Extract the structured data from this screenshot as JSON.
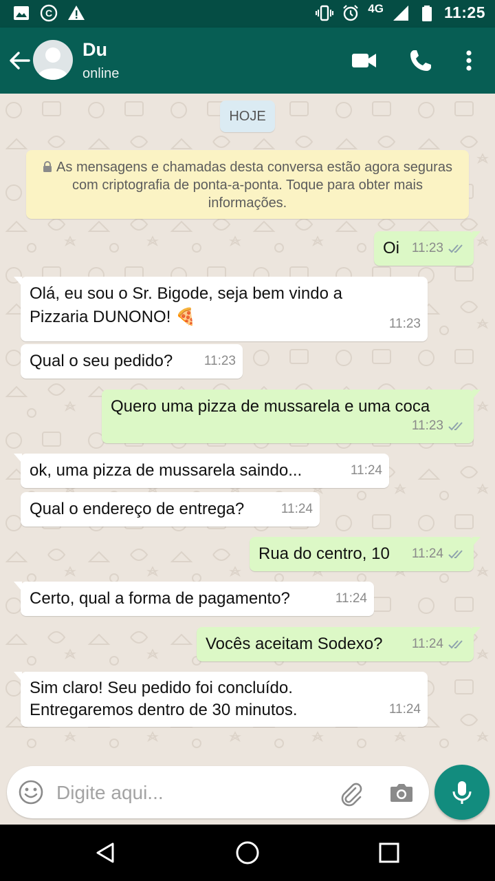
{
  "status_bar": {
    "network": "4G",
    "time": "11:25",
    "icons": [
      "image-icon",
      "copyright-icon",
      "warning-icon",
      "vibrate-icon",
      "alarm-icon",
      "signal-icon",
      "battery-icon"
    ]
  },
  "header": {
    "contact_name": "Du",
    "contact_status": "online",
    "icons": [
      "back-arrow-icon",
      "avatar-icon",
      "video-call-icon",
      "phone-icon",
      "more-vert-icon"
    ]
  },
  "chat": {
    "date_label": "HOJE",
    "encryption_notice": "As mensagens e chamadas desta conversa estão agora seguras com criptografia de ponta-a-ponta. Toque para obter mais informações.",
    "messages": [
      {
        "dir": "out",
        "lines": [
          "Oi"
        ],
        "time": "11:23",
        "read": true
      },
      {
        "dir": "in",
        "lines": [
          "Olá, eu sou o Sr. Bigode, seja bem vindo a",
          "Pizzaria DUNONO! 🍕"
        ],
        "time": "11:23"
      },
      {
        "dir": "in",
        "lines": [
          "Qual o seu pedido?"
        ],
        "time": "11:23"
      },
      {
        "dir": "out",
        "lines": [
          "Quero uma pizza de mussarela e uma coca"
        ],
        "time": "11:23",
        "read": true
      },
      {
        "dir": "in",
        "lines": [
          "ok, uma pizza de mussarela saindo..."
        ],
        "time": "11:24"
      },
      {
        "dir": "in",
        "lines": [
          "Qual o endereço de entrega?"
        ],
        "time": "11:24"
      },
      {
        "dir": "out",
        "lines": [
          "Rua do centro, 10"
        ],
        "time": "11:24",
        "read": true
      },
      {
        "dir": "in",
        "lines": [
          "Certo, qual a forma de pagamento?"
        ],
        "time": "11:24"
      },
      {
        "dir": "out",
        "lines": [
          "Vocês aceitam Sodexo?"
        ],
        "time": "11:24",
        "read": true
      },
      {
        "dir": "in",
        "lines": [
          "Sim claro! Seu pedido foi concluído.",
          "Entregaremos dentro de 30 minutos."
        ],
        "time": "11:24"
      }
    ]
  },
  "composer": {
    "placeholder": "Digite aqui...",
    "icons": [
      "emoji-icon",
      "attach-icon",
      "camera-icon",
      "mic-icon"
    ]
  },
  "colors": {
    "status_bar": "#054D44",
    "header": "#075E54",
    "chat_bg": "#ECE5DD",
    "incoming_bubble": "#FFFFFF",
    "outgoing_bubble": "#DCF8C6",
    "notice_bg": "#FBF3C4",
    "date_chip": "#DBEBF3",
    "mic_button": "#128C7E",
    "read_ticks": "#8FA3AD"
  },
  "nav_bar": {
    "icons": [
      "back-triangle-icon",
      "home-circle-icon",
      "recents-square-icon"
    ]
  }
}
